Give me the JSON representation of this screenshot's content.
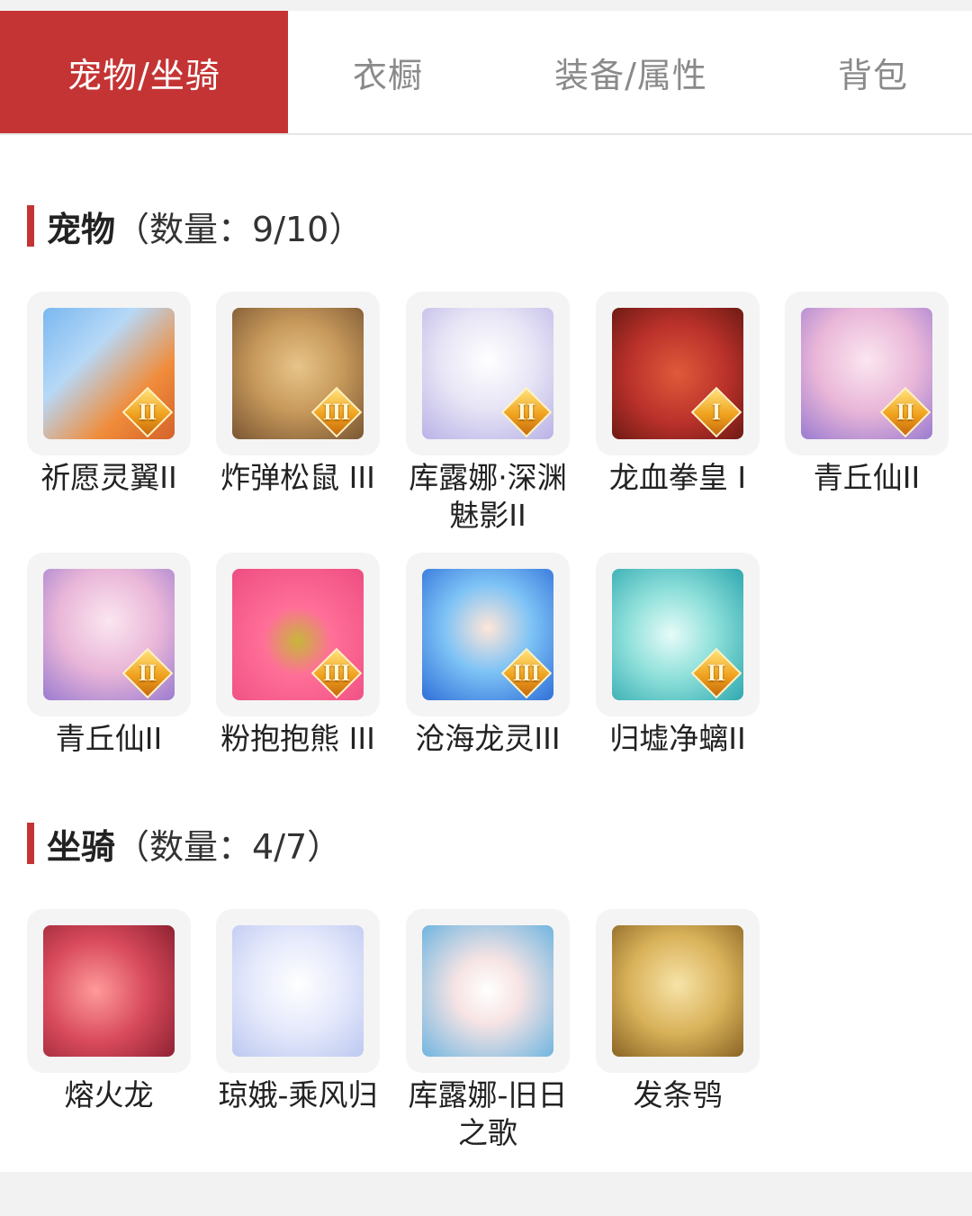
{
  "tabs": [
    {
      "label": "宠物/坐骑",
      "active": true
    },
    {
      "label": "衣橱",
      "active": false
    },
    {
      "label": "装备/属性",
      "active": false
    },
    {
      "label": "背包",
      "active": false
    }
  ],
  "pets_section": {
    "title": "宠物",
    "count": "（数量：9/10）",
    "items": [
      {
        "name": "祈愿灵翼II",
        "icon": "griffin-pet-icon",
        "badge": "II"
      },
      {
        "name": "炸弹松鼠 III",
        "icon": "squirrel-pet-icon",
        "badge": "III"
      },
      {
        "name": "库露娜·深渊魅影II",
        "icon": "kuluna-pet-icon",
        "badge": "II"
      },
      {
        "name": "龙血拳皇 I",
        "icon": "dragon-boxer-pet-icon",
        "badge": "I"
      },
      {
        "name": "青丘仙II",
        "icon": "fox-fairy-pet-icon",
        "badge": "II"
      },
      {
        "name": "青丘仙II",
        "icon": "fox-fairy-pet-icon",
        "badge": "II"
      },
      {
        "name": "粉抱抱熊 III",
        "icon": "pink-bear-pet-icon",
        "badge": "III"
      },
      {
        "name": "沧海龙灵III",
        "icon": "sea-dragon-spirit-pet-icon",
        "badge": "III"
      },
      {
        "name": "归墟净螭II",
        "icon": "jade-dragon-pet-icon",
        "badge": "II"
      }
    ]
  },
  "mounts_section": {
    "title": "坐骑",
    "count": "（数量：4/7）",
    "items": [
      {
        "name": "熔火龙",
        "icon": "lava-dragon-mount-icon"
      },
      {
        "name": "琼娥-乘风归",
        "icon": "moon-fairy-mount-icon"
      },
      {
        "name": "库露娜-旧日之歌",
        "icon": "kuluna-song-mount-icon"
      },
      {
        "name": "发条鸮",
        "icon": "clockwork-owl-mount-icon"
      }
    ]
  },
  "colors": {
    "accent": "#c43434",
    "tab_inactive_text": "#8a8a8a",
    "thumb_bg": "#f4f4f4"
  }
}
